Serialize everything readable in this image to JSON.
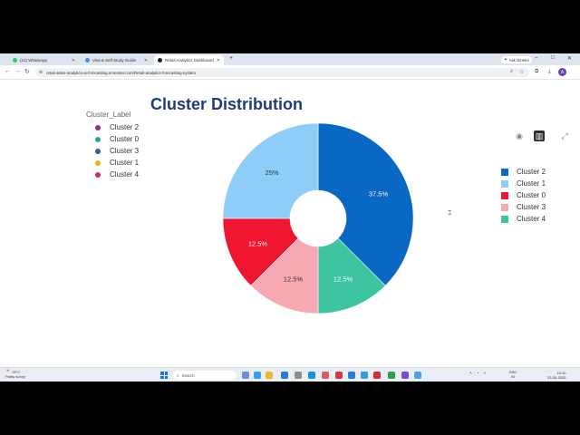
{
  "browser": {
    "tabs": [
      {
        "label": "(21) WhatsApp",
        "active": false,
        "color": "#25d366"
      },
      {
        "label": "Visa & Self Study Guide",
        "active": false,
        "color": "#4a90d9"
      },
      {
        "label": "Retail Analytics Dashboard",
        "active": true,
        "color": "#222222"
      }
    ],
    "new_tab": "+",
    "ask_gemini": "Ask Gemini",
    "url": "retail-sales-analytics-ai-forecasting.onrender.com/Retail-analytics-forecasting-system",
    "profile_initial": "A"
  },
  "dashboard": {
    "title": "Cluster Distribution",
    "left_legend": {
      "header": "Cluster_Label",
      "items": [
        {
          "label": "Cluster 2",
          "color": "#8b2f86"
        },
        {
          "label": "Cluster 0",
          "color": "#2aa39a"
        },
        {
          "label": "Cluster 3",
          "color": "#3a5a9a"
        },
        {
          "label": "Cluster 1",
          "color": "#e8b21c"
        },
        {
          "label": "Cluster 4",
          "color": "#c62c6a"
        }
      ]
    },
    "modebar": {
      "camera": "camera-icon",
      "chart": "bar-chart-icon",
      "expand": "expand-icon"
    }
  },
  "chart_data": {
    "type": "pie",
    "hole": true,
    "title": "",
    "slices": [
      {
        "label": "Cluster 2",
        "value": 37.5,
        "text": "37.5%",
        "color": "#0868c3"
      },
      {
        "label": "Cluster 4",
        "value": 12.5,
        "text": "12.5%",
        "color": "#3dc4a0"
      },
      {
        "label": "Cluster 3",
        "value": 12.5,
        "text": "12.5%",
        "color": "#f7a8b0"
      },
      {
        "label": "Cluster 0",
        "value": 12.5,
        "text": "12.5%",
        "color": "#ef1430"
      },
      {
        "label": "Cluster 1",
        "value": 25,
        "text": "25%",
        "color": "#8ecdf8"
      }
    ],
    "legend": {
      "placement": "right",
      "items": [
        "Cluster 2",
        "Cluster 1",
        "Cluster 0",
        "Cluster 3",
        "Cluster 4"
      ]
    }
  },
  "taskbar": {
    "weather_temp": "39°C",
    "weather_desc": "Partly sunny",
    "search_label": "Search",
    "lang": "ENG\nIN",
    "time": "15:10",
    "date": "23-06-2025"
  }
}
